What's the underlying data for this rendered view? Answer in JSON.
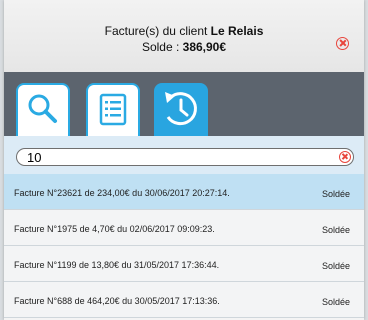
{
  "header": {
    "title_prefix": "Facture(s)  du client",
    "client_name": "Le Relais",
    "solde_label": "Solde  :",
    "solde_value": "386,90€"
  },
  "tabs": [
    {
      "icon": "search-icon",
      "active": false
    },
    {
      "icon": "list-icon",
      "active": false
    },
    {
      "icon": "history-icon",
      "active": true
    }
  ],
  "search": {
    "value": "10"
  },
  "colors": {
    "accent": "#29a5e0",
    "tabbar": "#5c646e",
    "selected_row": "#bfe0f3",
    "close": "#e8453c"
  },
  "invoices": [
    {
      "text": "Facture N°23621 de 234,00€ du 30/06/2017 20:27:14.",
      "status": "Soldée"
    },
    {
      "text": "Facture N°1975 de 4,70€ du 02/06/2017 09:09:23.",
      "status": "Soldée"
    },
    {
      "text": "Facture N°1199 de 13,80€ du 31/05/2017 17:36:44.",
      "status": "Soldée"
    },
    {
      "text": "Facture N°688 de 464,20€ du 30/05/2017 17:13:36.",
      "status": "Soldée"
    }
  ]
}
